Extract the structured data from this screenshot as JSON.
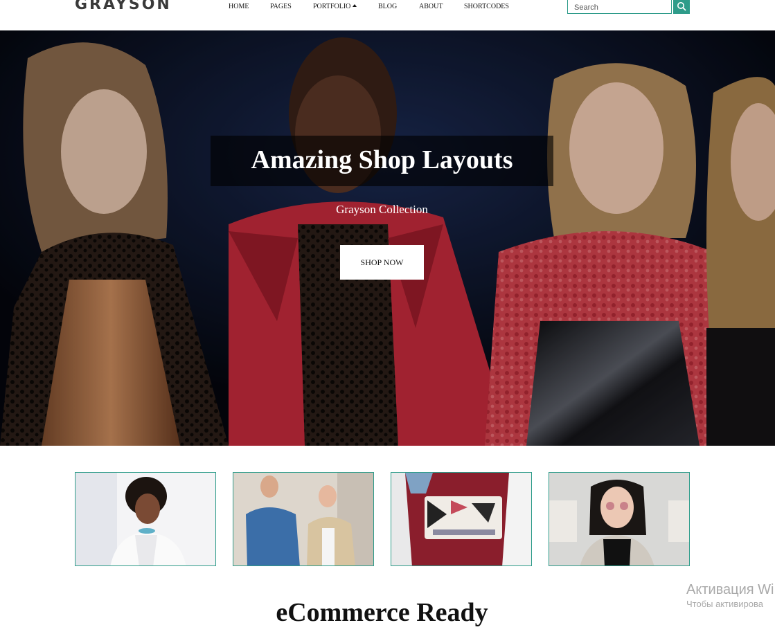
{
  "brand": {
    "logo_text": "GRAYSON"
  },
  "nav": {
    "items": [
      {
        "label": "HOME"
      },
      {
        "label": "PAGES"
      },
      {
        "label": "PORTFOLIO",
        "has_dropdown": true
      },
      {
        "label": "BLOG"
      },
      {
        "label": "ABOUT"
      },
      {
        "label": "SHORTCODES"
      }
    ]
  },
  "search": {
    "placeholder": "Search",
    "value": "",
    "button_icon": "search-icon"
  },
  "hero": {
    "title": "Amazing Shop Layouts",
    "subtitle": "Grayson Collection",
    "cta_label": "SHOP NOW"
  },
  "thumbnails": [
    {
      "name": "woman-curly-hair-white-jacket"
    },
    {
      "name": "two-men-denim-jackets"
    },
    {
      "name": "patterned-clutch-red-skirt"
    },
    {
      "name": "woman-tinted-glasses-grey-coat"
    }
  ],
  "section": {
    "title": "eCommerce Ready"
  },
  "watermark": {
    "title": "Активация Wi",
    "subtitle": "Чтобы активирова"
  },
  "colors": {
    "accent": "#2e9c8a",
    "text": "#111111",
    "logo": "#3a3a3a",
    "hero_overlay": "#000000"
  }
}
